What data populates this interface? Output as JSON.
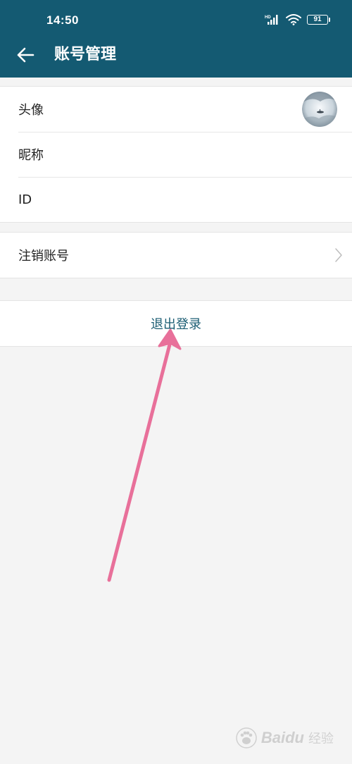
{
  "status_bar": {
    "time": "14:50",
    "battery": "91",
    "network_badge": "HD"
  },
  "header": {
    "title": "账号管理"
  },
  "profile": {
    "avatar_label": "头像",
    "nickname_label": "昵称",
    "id_label": "ID"
  },
  "account": {
    "deactivate_label": "注销账号"
  },
  "logout": {
    "label": "退出登录"
  },
  "watermark": {
    "brand": "Baidu",
    "sub": "经验"
  },
  "colors": {
    "header_bg": "#145a72",
    "accent_text": "#1b5d73",
    "annotation_arrow": "#e8709a",
    "page_bg": "#f4f4f4"
  }
}
